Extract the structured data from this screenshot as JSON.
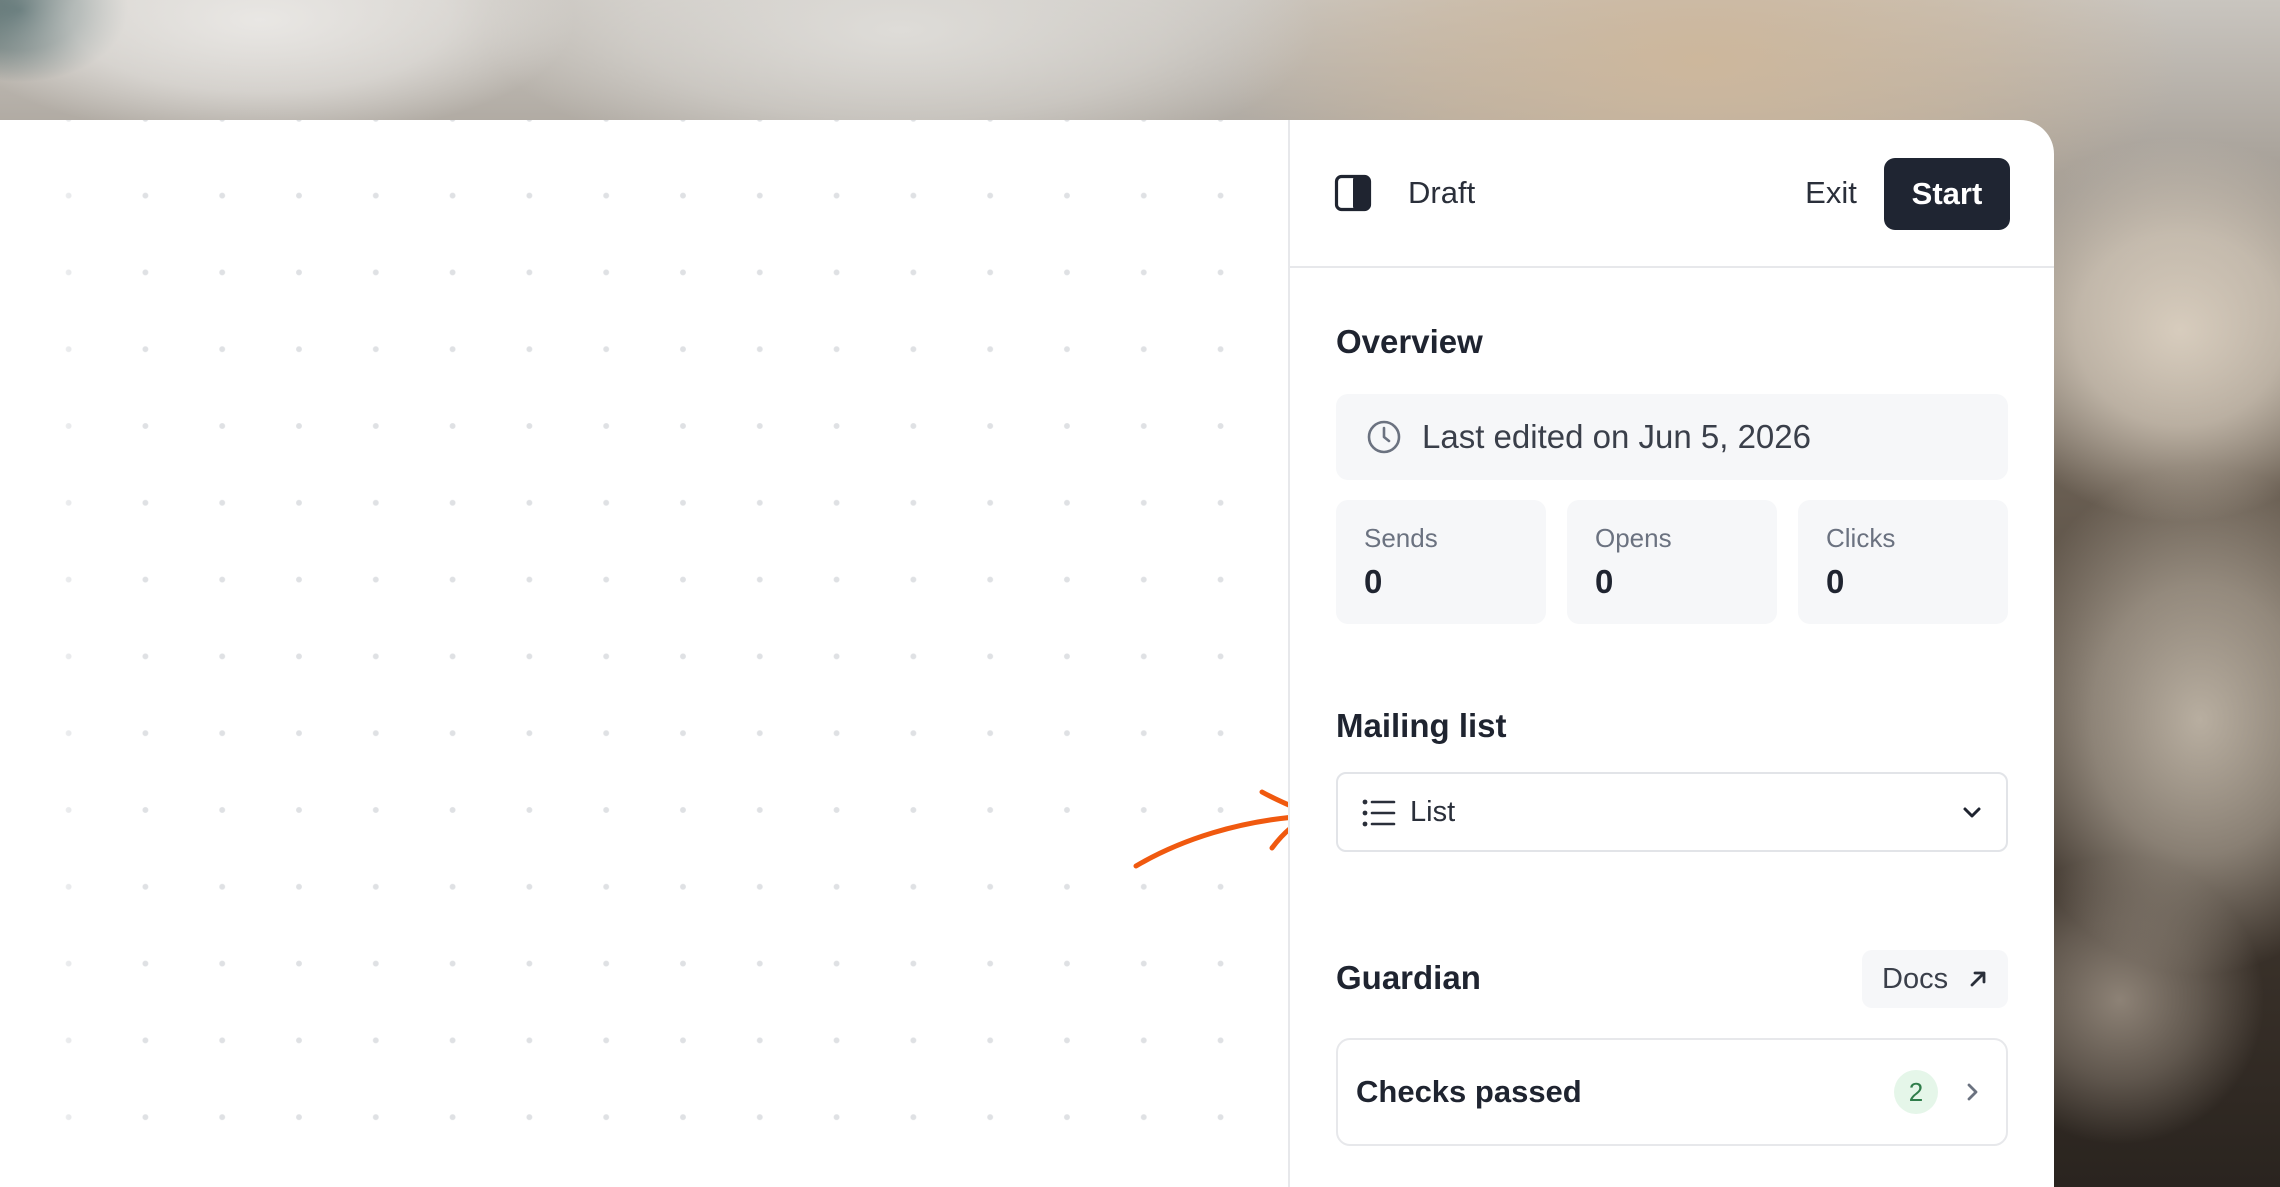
{
  "header": {
    "status_label": "Draft",
    "exit_label": "Exit",
    "start_label": "Start",
    "panel_toggle_icon": "sidebar-panel-icon"
  },
  "overview": {
    "title": "Overview",
    "last_edited": "Last edited on Jun 5, 2026",
    "clock_icon": "clock-icon",
    "stats": [
      {
        "label": "Sends",
        "value": "0"
      },
      {
        "label": "Opens",
        "value": "0"
      },
      {
        "label": "Clicks",
        "value": "0"
      }
    ]
  },
  "mailing_list": {
    "title": "Mailing list",
    "selected_value": "List",
    "list_icon": "list-icon",
    "dropdown_icon": "chevron-down-icon"
  },
  "guardian": {
    "title": "Guardian",
    "docs_label": "Docs",
    "docs_icon": "arrow-up-right-icon",
    "checks_label": "Checks passed",
    "checks_count": "2",
    "checks_icon": "chevron-right-icon"
  },
  "colors": {
    "primary_button": "#1f2532",
    "annotation_arrow": "#f0590f",
    "success_badge_bg": "#e5f6e9",
    "success_badge_text": "#2f7d4a"
  }
}
